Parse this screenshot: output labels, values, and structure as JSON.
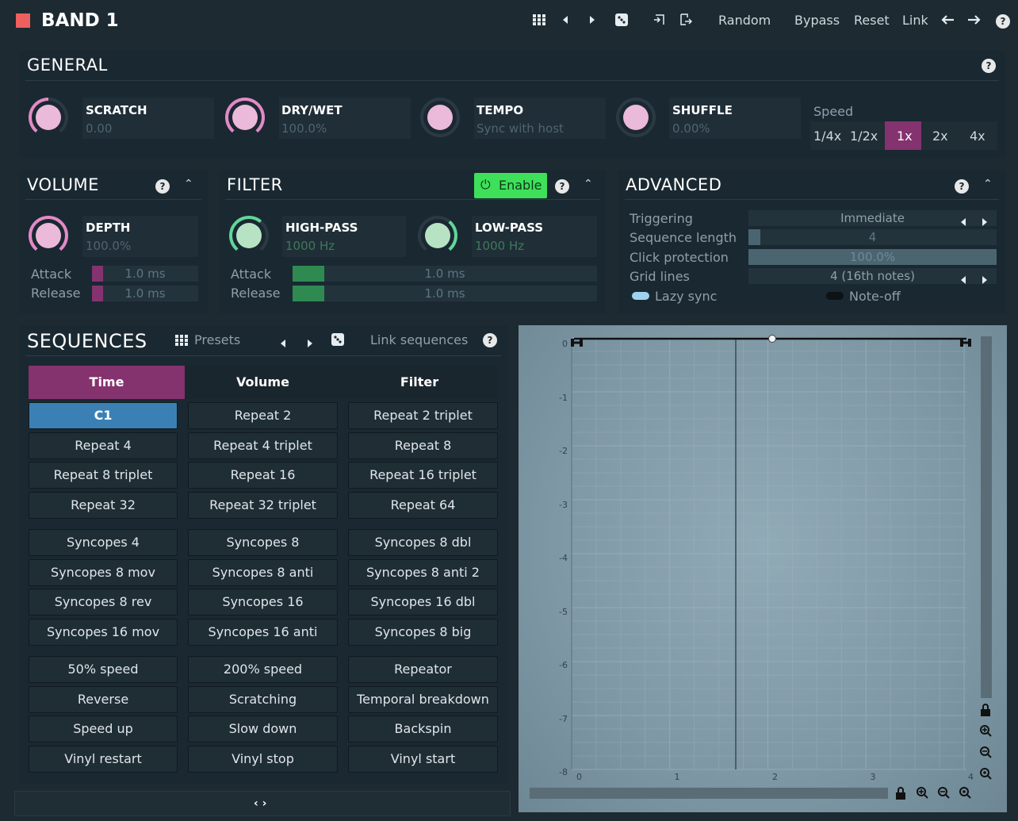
{
  "header": {
    "title": "BAND 1",
    "random": "Random",
    "bypass": "Bypass",
    "reset": "Reset",
    "link": "Link"
  },
  "general": {
    "title": "GENERAL",
    "knobs": [
      {
        "label": "SCRATCH",
        "value": "0.00"
      },
      {
        "label": "DRY/WET",
        "value": "100.0%"
      },
      {
        "label": "TEMPO",
        "value": "Sync with host"
      },
      {
        "label": "SHUFFLE",
        "value": "0.00%"
      }
    ],
    "speed": {
      "label": "Speed",
      "options": [
        "1/4x",
        "1/2x",
        "1x",
        "2x",
        "4x"
      ],
      "selected": "1x"
    }
  },
  "volume": {
    "title": "VOLUME",
    "depth": {
      "label": "DEPTH",
      "value": "100.0%"
    },
    "attack": {
      "label": "Attack",
      "value": "1.0 ms"
    },
    "release": {
      "label": "Release",
      "value": "1.0 ms"
    }
  },
  "filter": {
    "title": "FILTER",
    "enable": "Enable",
    "highpass": {
      "label": "HIGH-PASS",
      "value": "1000 Hz"
    },
    "lowpass": {
      "label": "LOW-PASS",
      "value": "1000 Hz"
    },
    "attack": {
      "label": "Attack",
      "value": "1.0 ms"
    },
    "release": {
      "label": "Release",
      "value": "1.0 ms"
    }
  },
  "advanced": {
    "title": "ADVANCED",
    "triggering": {
      "label": "Triggering",
      "value": "Immediate"
    },
    "seqlen": {
      "label": "Sequence length",
      "value": "4"
    },
    "click": {
      "label": "Click protection",
      "value": "100.0%"
    },
    "grid": {
      "label": "Grid lines",
      "value": "4 (16th notes)"
    },
    "lazy": "Lazy sync",
    "noteoff": "Note-off"
  },
  "sequences": {
    "title": "SEQUENCES",
    "presets": "Presets",
    "link": "Link sequences",
    "tabs": [
      "Time",
      "Volume",
      "Filter"
    ],
    "group1": [
      "C1",
      "Repeat 2",
      "Repeat 2 triplet",
      "Repeat 4",
      "Repeat 4 triplet",
      "Repeat 8",
      "Repeat 8 triplet",
      "Repeat 16",
      "Repeat 16 triplet",
      "Repeat 32",
      "Repeat 32 triplet",
      "Repeat 64"
    ],
    "group2": [
      "Syncopes 4",
      "Syncopes 8",
      "Syncopes 8 dbl",
      "Syncopes 8 mov",
      "Syncopes 8 anti",
      "Syncopes 8 anti 2",
      "Syncopes 8 rev",
      "Syncopes 16",
      "Syncopes 16 dbl",
      "Syncopes 16 mov",
      "Syncopes 16 anti",
      "Syncopes 8 big"
    ],
    "group3": [
      "50% speed",
      "200% speed",
      "Repeator",
      "Reverse",
      "Scratching",
      "Temporal breakdown",
      "Speed up",
      "Slow down",
      "Backspin",
      "Vinyl restart",
      "Vinyl stop",
      "Vinyl start"
    ]
  },
  "graph": {
    "yticks": [
      "0",
      "-1",
      "-2",
      "-3",
      "-4",
      "-5",
      "-6",
      "-7",
      "-8"
    ],
    "xticks": [
      "0",
      "1",
      "2",
      "3",
      "4"
    ]
  },
  "footer": {
    "expand": "‹ ›"
  }
}
